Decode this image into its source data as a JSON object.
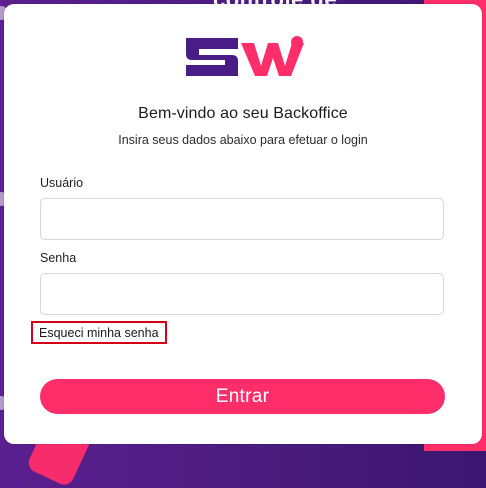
{
  "background": {
    "top_text": "controle de"
  },
  "colors": {
    "primary_pink": "#ff2d6a",
    "primary_purple": "#5b1f8f",
    "highlight_red": "#d4001a"
  },
  "logo": {
    "text": "SW"
  },
  "login": {
    "title": "Bem-vindo ao seu Backoffice",
    "subtitle": "Insira seus dados abaixo para efetuar o login",
    "username_label": "Usuário",
    "username_value": "",
    "password_label": "Senha",
    "password_value": "",
    "forgot_password": "Esqueci minha senha",
    "submit": "Entrar"
  }
}
